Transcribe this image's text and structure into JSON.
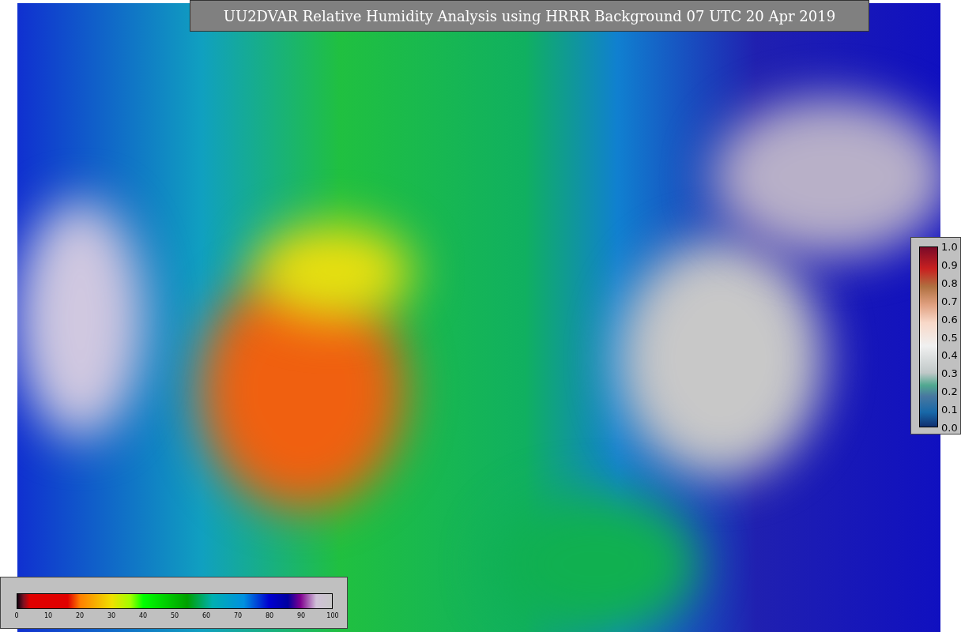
{
  "title": "UU2DVAR Relative Humidity Analysis using HRRR Background 07 UTC 20 Apr 2019",
  "colorbar_horizontal": {
    "ticks": [
      "0",
      "10",
      "20",
      "30",
      "40",
      "50",
      "60",
      "70",
      "80",
      "90",
      "100"
    ]
  },
  "colorbar_vertical": {
    "ticks": [
      "1.0",
      "0.9",
      "0.8",
      "0.7",
      "0.6",
      "0.5",
      "0.4",
      "0.3",
      "0.2",
      "0.1",
      "0.0"
    ]
  }
}
